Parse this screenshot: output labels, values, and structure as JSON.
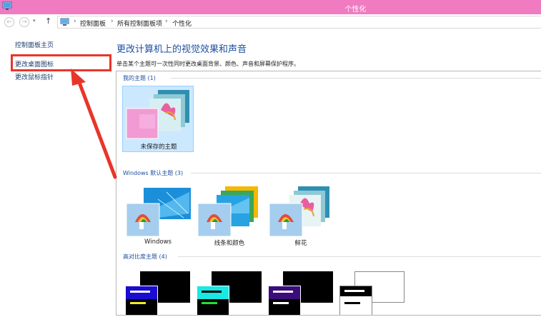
{
  "window": {
    "title": "个性化"
  },
  "navbar": {
    "back_glyph": "←",
    "forward_glyph": "→",
    "dropdown_glyph": "▾",
    "up_glyph": "↑",
    "breadcrumb": [
      "控制面板",
      "所有控制面板项",
      "个性化"
    ],
    "separator": "›"
  },
  "left_panel": {
    "links": [
      {
        "label": "控制面板主页"
      },
      {
        "label": "更改桌面图标"
      },
      {
        "label": "更改鼠标指针"
      }
    ],
    "highlight_color": "#e8352a"
  },
  "main": {
    "title": "更改计算机上的视觉效果和声音",
    "description": "单击某个主题可一次性同时更改桌面背景、颜色、声音和屏幕保护程序。",
    "groups": [
      {
        "label": "我的主题 (1)",
        "themes": [
          {
            "label": "未保存的主题",
            "selected": true
          }
        ]
      },
      {
        "label": "Windows 默认主题 (3)",
        "themes": [
          {
            "label": "Windows"
          },
          {
            "label": "线条和颜色"
          },
          {
            "label": "鲜花"
          }
        ]
      },
      {
        "label": "高对比度主题 (4)"
      }
    ]
  },
  "colors": {
    "titlebar": "#f07bc1",
    "link": "#1e4fa0",
    "selected_bg": "#cce8ff",
    "annotation": "#e8352a"
  }
}
